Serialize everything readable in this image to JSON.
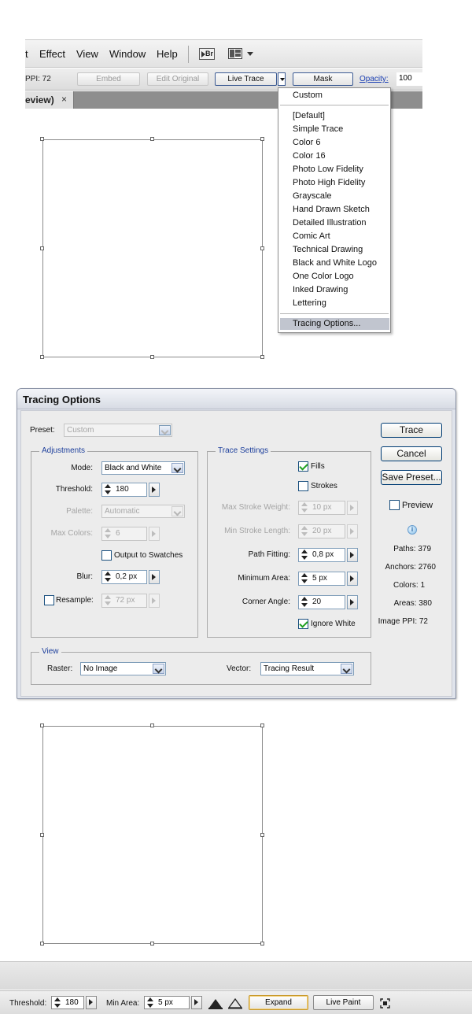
{
  "menubar": {
    "items": [
      "t",
      "Effect",
      "View",
      "Window",
      "Help"
    ]
  },
  "icons": {
    "bridge": "bridge-icon",
    "workspace": "workspace-switcher-icon",
    "close": "close-icon",
    "info": "info-icon",
    "fit": "fit-screen-icon"
  },
  "controlbar": {
    "ppi_label": "PPI: 72",
    "embed_label": "Embed",
    "edit_original_label": "Edit Original",
    "live_trace_label": "Live Trace",
    "mask_label": "Mask",
    "opacity_label": "Opacity:",
    "opacity_value": "100"
  },
  "doc_tab": {
    "label": "eview)",
    "close": "×"
  },
  "preset_menu": {
    "custom": "Custom",
    "items": [
      "[Default]",
      "Simple Trace",
      "Color 6",
      "Color 16",
      "Photo Low Fidelity",
      "Photo High Fidelity",
      "Grayscale",
      "Hand Drawn Sketch",
      "Detailed Illustration",
      "Comic Art",
      "Technical Drawing",
      "Black and White Logo",
      "One Color Logo",
      "Inked Drawing",
      "Lettering"
    ],
    "tracing_options": "Tracing Options..."
  },
  "dialog": {
    "title": "Tracing Options",
    "preset_label": "Preset:",
    "preset_value": "Custom",
    "adjustments": {
      "title": "Adjustments",
      "mode_label": "Mode:",
      "mode_value": "Black and White",
      "threshold_label": "Threshold:",
      "threshold_value": "180",
      "palette_label": "Palette:",
      "palette_value": "Automatic",
      "max_colors_label": "Max Colors:",
      "max_colors_value": "6",
      "output_swatches_label": "Output to Swatches",
      "output_swatches_checked": false,
      "blur_label": "Blur:",
      "blur_value": "0,2 px",
      "resample_label": "Resample:",
      "resample_checked": false,
      "resample_value": "72 px"
    },
    "trace_settings": {
      "title": "Trace Settings",
      "fills_label": "Fills",
      "fills_checked": true,
      "strokes_label": "Strokes",
      "strokes_checked": false,
      "max_stroke_weight_label": "Max Stroke Weight:",
      "max_stroke_weight_value": "10 px",
      "min_stroke_length_label": "Min Stroke Length:",
      "min_stroke_length_value": "20 px",
      "path_fitting_label": "Path Fitting:",
      "path_fitting_value": "0,8 px",
      "minimum_area_label": "Minimum Area:",
      "minimum_area_value": "5 px",
      "corner_angle_label": "Corner Angle:",
      "corner_angle_value": "20",
      "ignore_white_label": "Ignore White",
      "ignore_white_checked": true
    },
    "view": {
      "title": "View",
      "raster_label": "Raster:",
      "raster_value": "No Image",
      "vector_label": "Vector:",
      "vector_value": "Tracing Result"
    },
    "buttons": {
      "trace": "Trace",
      "cancel": "Cancel",
      "save_preset": "Save Preset..."
    },
    "preview_label": "Preview",
    "preview_checked": false,
    "stats": {
      "paths": "Paths: 379",
      "anchors": "Anchors: 2760",
      "colors": "Colors: 1",
      "areas": "Areas: 380",
      "image_ppi": "Image PPI: 72"
    }
  },
  "bottombar": {
    "threshold_label": "Threshold:",
    "threshold_value": "180",
    "min_area_label": "Min Area:",
    "min_area_value": "5 px",
    "expand_label": "Expand",
    "live_paint_label": "Live Paint"
  },
  "colors": {
    "dialog_bg": "#ececec",
    "group_title": "#1d3f9c",
    "opacity_link": "#1b3fb3",
    "menu_highlight": "#c1c5cf",
    "checkmark": "#21a121"
  }
}
